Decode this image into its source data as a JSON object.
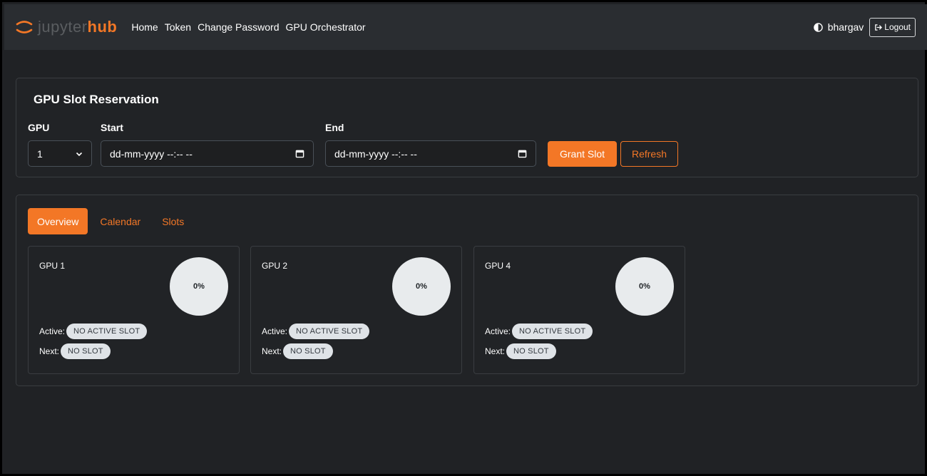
{
  "navbar": {
    "brand_light": "jupyter",
    "brand_bold": "hub",
    "links": [
      "Home",
      "Token",
      "Change Password",
      "GPU Orchestrator"
    ],
    "user": "bhargav",
    "logout_label": "Logout",
    "accent": "#f37726"
  },
  "reservation": {
    "title": "GPU Slot Reservation",
    "gpu_label": "GPU",
    "gpu_value": "1",
    "start_label": "Start",
    "start_placeholder": "dd-mm-yyyy --:-- --",
    "end_label": "End",
    "end_placeholder": "dd-mm-yyyy --:-- --",
    "grant_label": "Grant Slot",
    "refresh_label": "Refresh"
  },
  "tabs": [
    "Overview",
    "Calendar",
    "Slots"
  ],
  "gpus": [
    {
      "name": "GPU 1",
      "usage": "0%",
      "active_label": "Active:",
      "active_value": "NO ACTIVE SLOT",
      "next_label": "Next:",
      "next_value": "NO SLOT"
    },
    {
      "name": "GPU 2",
      "usage": "0%",
      "active_label": "Active:",
      "active_value": "NO ACTIVE SLOT",
      "next_label": "Next:",
      "next_value": "NO SLOT"
    },
    {
      "name": "GPU 4",
      "usage": "0%",
      "active_label": "Active:",
      "active_value": "NO ACTIVE SLOT",
      "next_label": "Next:",
      "next_value": "NO SLOT"
    }
  ]
}
